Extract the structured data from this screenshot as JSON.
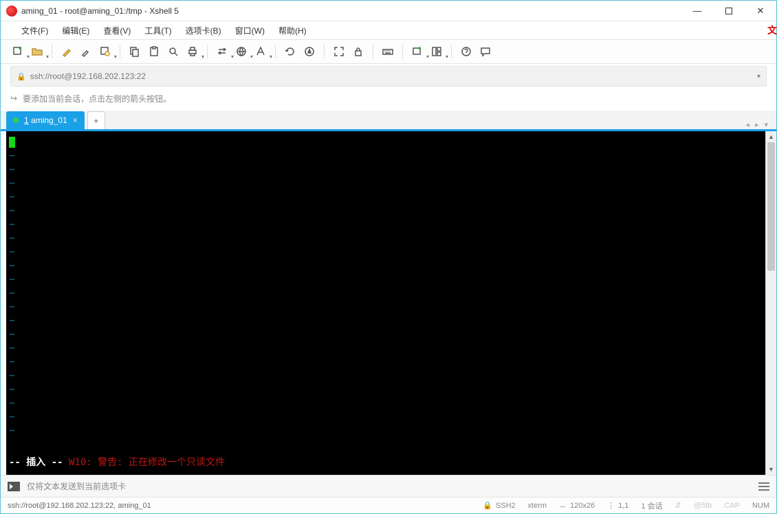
{
  "title": "aming_01 - root@aming_01:/tmp - Xshell 5",
  "menu": [
    "文件(F)",
    "编辑(E)",
    "查看(V)",
    "工具(T)",
    "选项卡(B)",
    "窗口(W)",
    "帮助(H)"
  ],
  "address": "ssh://root@192.168.202.123:22",
  "hint": "要添加当前会话，点击左侧的箭头按钮。",
  "tab": {
    "index": "1",
    "label": "aming_01"
  },
  "terminal": {
    "tilde_rows": 21,
    "status_insert": "-- 插入 --  ",
    "status_warn": "W10: 警告: 正在修改一个只读文件"
  },
  "input_hint": "仅将文本发送到当前选项卡",
  "status": {
    "left": "ssh://root@192.168.202.123:22, aming_01",
    "proto": "SSH2",
    "term": "xterm",
    "size": "120x26",
    "pos": "1,1",
    "sessions": "1 会话",
    "cap": "CAP",
    "num": "NUM"
  },
  "watermark": "@5tb"
}
